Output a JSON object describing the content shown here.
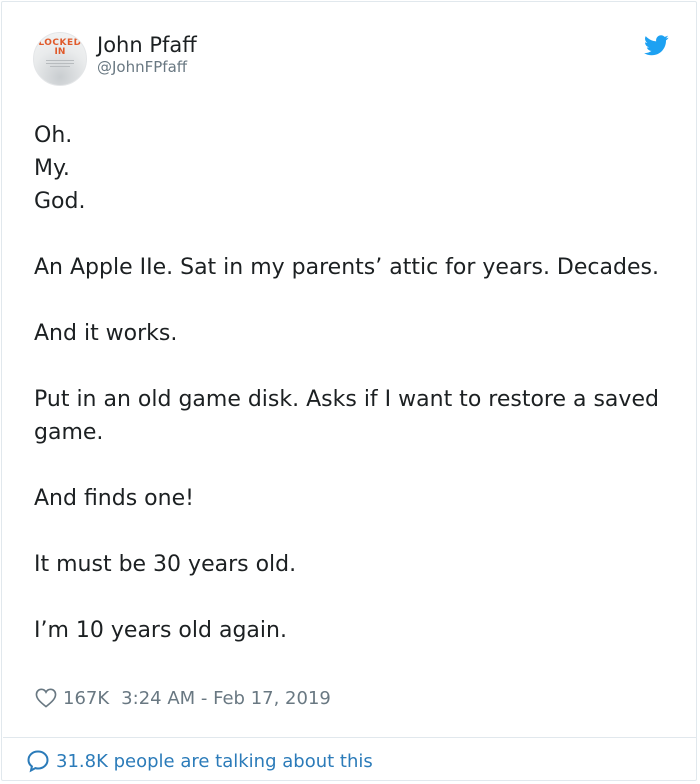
{
  "author": {
    "name": "John Pfaff",
    "handle": "@JohnFPfaff",
    "avatar_text_line1": "LOCKED",
    "avatar_text_line2": "IN",
    "avatar_icon": "book-cover-avatar"
  },
  "platform_icon": "twitter-bird-icon",
  "tweet": {
    "paragraphs": [
      "Oh.\nMy.\nGod.",
      "An Apple IIe. Sat in my parents’ attic for years. Decades.",
      "And it works.",
      "Put in an old game disk. Asks if I want to restore a saved game.",
      "And finds one!",
      "It must be 30 years old.",
      "I’m 10 years old again."
    ]
  },
  "meta": {
    "likes": "167K",
    "timestamp": "3:24 AM - Feb 17, 2019"
  },
  "footer": {
    "talking_text": "31.8K people are talking about this"
  },
  "colors": {
    "twitter_blue": "#1da1f2",
    "link_blue": "#2b7bb9",
    "muted_gray": "#697882",
    "text_dark": "#1c2022",
    "avatar_orange": "#e05a2b"
  }
}
